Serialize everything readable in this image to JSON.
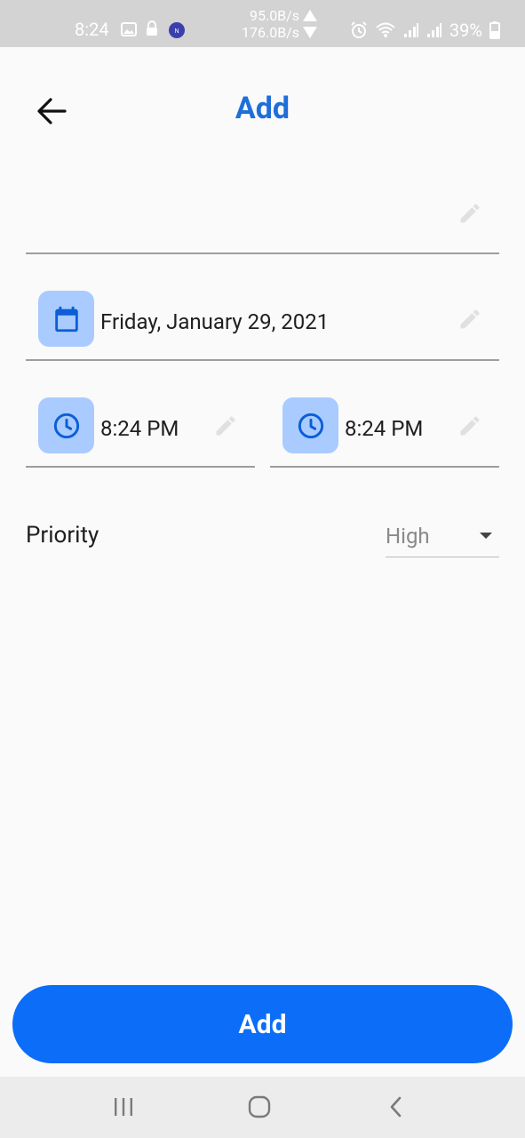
{
  "status_bar": {
    "time": "8:24",
    "upload_rate": "95.0B/s",
    "download_rate": "176.0B/s",
    "battery": "39%",
    "icons": [
      "image-icon",
      "lock-icon",
      "notification-app-icon",
      "alarm-icon",
      "wifi-icon",
      "signal-icon",
      "signal-icon",
      "battery-icon"
    ]
  },
  "header": {
    "title": "Add",
    "back_icon": "arrow-left-icon"
  },
  "form": {
    "title_field": {
      "value": "",
      "edit_icon": "pencil-icon"
    },
    "date_field": {
      "value": "Friday, January 29, 2021",
      "icon": "calendar-icon",
      "edit_icon": "pencil-icon"
    },
    "start_time_field": {
      "value": "8:24 PM",
      "icon": "clock-icon",
      "edit_icon": "pencil-icon"
    },
    "end_time_field": {
      "value": "8:24 PM",
      "icon": "clock-icon",
      "edit_icon": "pencil-icon"
    },
    "priority": {
      "label": "Priority",
      "selected": "High"
    }
  },
  "actions": {
    "add_label": "Add"
  },
  "nav_bar": {
    "items": [
      "recents-icon",
      "home-icon",
      "back-icon"
    ]
  },
  "colors": {
    "accent": "#1e6fd9",
    "button": "#0b6df8",
    "icon_tile": "#a9cbff",
    "icon_fg": "#0b5ed7",
    "status_bar": "#d3d3d3",
    "nav_bar": "#ececec"
  }
}
